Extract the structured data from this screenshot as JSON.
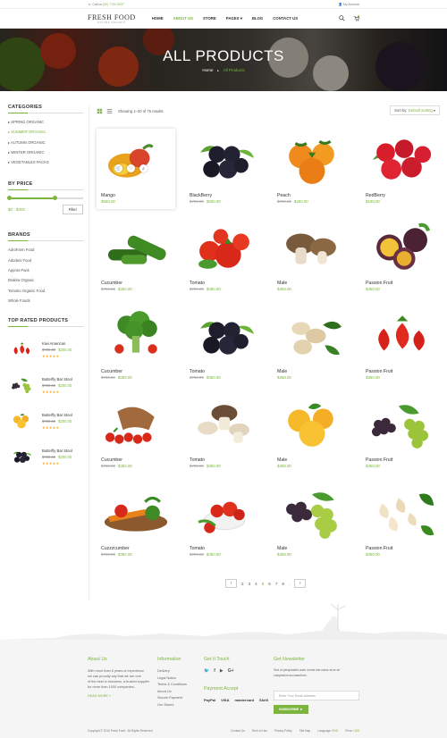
{
  "topbar": {
    "call_label": "Call us",
    "phone": "(00) 7700 6537",
    "account": "My Account"
  },
  "logo": {
    "title": "FRESH FOOD",
    "tagline": "NATURE ORGANIC"
  },
  "menu": [
    "HOME",
    "ABOUT US",
    "STORE",
    "PAGES",
    "BLOG",
    "CONTACT US"
  ],
  "menu_active": "ABOUT US",
  "hero": {
    "title": "ALL PRODUCTS",
    "crumb_home": "Home",
    "crumb_sep": "►",
    "crumb_current": "All Products"
  },
  "sidebar": {
    "categories_title": "CATEGORIES",
    "categories": [
      "SPRING ORGANIC",
      "SUMMER ORGANIC",
      "AUTUMN ORGANIC",
      "WINTER ORGANIC",
      "VEGETABLES PACKS"
    ],
    "active_category": "SUMMER ORGANIC",
    "price_title": "BY PRICE",
    "price_range": "$0 - $400",
    "price_fill": 0.62,
    "filter_label": "Filter",
    "brands_title": "BRANDS",
    "brands": [
      "AdroFarm Food",
      "Adodeni Food",
      "Appros Pack",
      "Brakira Organic",
      "Tomoko Organic Food",
      "Whole Foods"
    ],
    "top_rated_title": "TOP RATED PRODUCTS",
    "top_rated": [
      {
        "name": "Kiwi American",
        "old": "$780.00",
        "new": "$250.00",
        "stars": "★★★★★"
      },
      {
        "name": "Butterfly Bar Stool",
        "old": "$780.00",
        "new": "$250.00",
        "stars": "★★★★★"
      },
      {
        "name": "Butterfly Bar Stool",
        "old": "$780.00",
        "new": "$250.00",
        "stars": "★★★★★"
      },
      {
        "name": "Butterfly Bar Stool",
        "old": "$780.00",
        "new": "$250.00",
        "stars": "★★★★★"
      }
    ]
  },
  "toolbar": {
    "showing": "Showing 1–20 of 75 results",
    "sort_label": "Sort by:",
    "sort_value": "Default sorting"
  },
  "products": [
    {
      "name": "Mango",
      "old": "",
      "new": "$550.00",
      "icon": "mango"
    },
    {
      "name": "BlackBerry",
      "old": "$780.00",
      "new": "$550.00",
      "icon": "blackberry"
    },
    {
      "name": "Peach",
      "old": "$780.00",
      "new": "$290.00",
      "icon": "persimmon"
    },
    {
      "name": "RedBerry",
      "old": "",
      "new": "$190.00",
      "icon": "apples"
    },
    {
      "name": "Cucumber",
      "old": "$780.00",
      "new": "$350.00",
      "icon": "cucumber"
    },
    {
      "name": "Tomato",
      "old": "$780.00",
      "new": "$350.00",
      "icon": "tomato"
    },
    {
      "name": "Male",
      "old": "",
      "new": "$358.00",
      "icon": "mushroom"
    },
    {
      "name": "Passion Fruit",
      "old": "",
      "new": "$350.00",
      "icon": "passion"
    },
    {
      "name": "Cucumber",
      "old": "$780.00",
      "new": "$350.00",
      "icon": "broccoli"
    },
    {
      "name": "Tomato",
      "old": "$780.00",
      "new": "$350.00",
      "icon": "blackberry"
    },
    {
      "name": "Male",
      "old": "",
      "new": "$358.00",
      "icon": "pistachio"
    },
    {
      "name": "Passion Fruit",
      "old": "",
      "new": "$350.00",
      "icon": "strawberry"
    },
    {
      "name": "Cucumber",
      "old": "$780.00",
      "new": "$350.00",
      "icon": "basket"
    },
    {
      "name": "Tomato",
      "old": "$780.00",
      "new": "$350.00",
      "icon": "mushroom2"
    },
    {
      "name": "Male",
      "old": "",
      "new": "$358.00",
      "icon": "apricot"
    },
    {
      "name": "Passion Fruit",
      "old": "",
      "new": "$350.00",
      "icon": "grapes"
    },
    {
      "name": "Cuzzzcumber",
      "old": "$780.00",
      "new": "$350.00",
      "icon": "vegmix"
    },
    {
      "name": "Tomato",
      "old": "$780.00",
      "new": "$350.00",
      "icon": "tomatobowl"
    },
    {
      "name": "Male",
      "old": "",
      "new": "$358.00",
      "icon": "grapes2"
    },
    {
      "name": "Passion Fruit",
      "old": "",
      "new": "$350.00",
      "icon": "cashew"
    }
  ],
  "pagination": {
    "prev": "‹",
    "pages": [
      "2",
      "3",
      "4",
      "5",
      "6",
      "7",
      "8"
    ],
    "current": "5",
    "next": "›"
  },
  "footer": {
    "about_title": "About Us",
    "about_text": [
      "With more than 8 years of experience",
      "we can proudly say that we are one",
      "of the best in business, a trusted supplier",
      "for more than 1000 companies..."
    ],
    "about_more": "READ MORE  »",
    "info_title": "Information",
    "info_links": [
      "Delivery",
      "Legal Notice",
      "Terms & Conditions",
      "About Us",
      "Secure Payment",
      "Our Stores"
    ],
    "touch_title": "Get It Touch",
    "payment_title": "Payment Accept",
    "payments": [
      "PayPal",
      "VISA",
      "mastercard",
      "Skrill"
    ],
    "news_title": "Get Newsletter",
    "news_text": [
      "Sed ut perspiciatis unde omnis iste natus error sit",
      "voluptatem accusantium"
    ],
    "email_placeholder": "Enter Your Email Address",
    "subscribe": "SUBSCRIBE  ►",
    "copyright": "Copyright © 2016 Fresh Food . All Rights Reserved",
    "bottom_links": [
      "Contact Us",
      "Term of Use",
      "Privacy Policy",
      "Site Map"
    ],
    "language_label": "Language:",
    "language": "ENG",
    "price_label": "Price:",
    "currency": "USD"
  },
  "colors": {
    "accent": "#7cb43e",
    "star": "#f5a623"
  }
}
